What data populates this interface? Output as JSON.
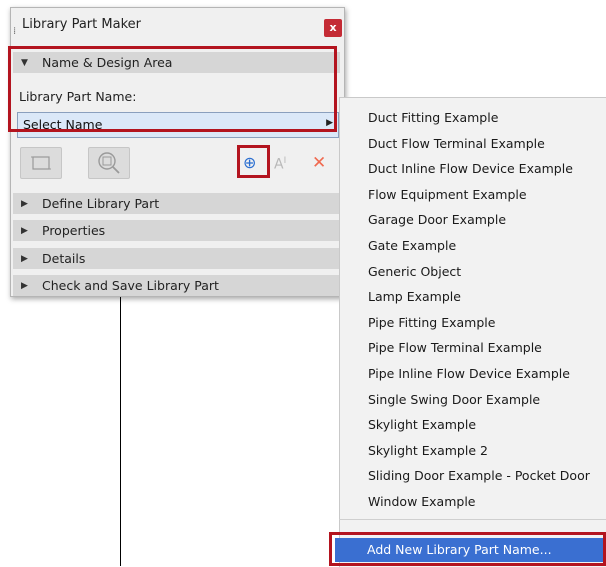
{
  "panel": {
    "title": "Library Part Maker",
    "close_label": "x",
    "name_section": {
      "header": "Name & Design Area",
      "name_label": "Library Part Name:",
      "select_value": "Select Name"
    },
    "toolbar": {
      "add_label": "⊕",
      "text_label": "A",
      "text_sup": "I",
      "delete_label": "✕"
    },
    "sections": [
      {
        "label": "Define Library Part"
      },
      {
        "label": "Properties"
      },
      {
        "label": "Details"
      },
      {
        "label": "Check and Save Library Part"
      }
    ]
  },
  "menu": {
    "items": [
      "Duct Fitting Example",
      "Duct Flow Terminal Example",
      "Duct Inline Flow Device Example",
      "Flow Equipment Example",
      "Garage Door Example",
      "Gate Example",
      "Generic Object",
      "Lamp Example",
      "Pipe Fitting Example",
      "Pipe Flow Terminal Example",
      "Pipe Inline Flow Device Example",
      "Single Swing Door Example",
      "Skylight Example",
      "Skylight Example 2",
      "Sliding Door Example - Pocket Door",
      "Window Example"
    ],
    "add_item": "Add New Library Part Name..."
  },
  "colors": {
    "highlight_red": "#b3141f",
    "menu_selected": "#3a6fd1",
    "select_bg": "#dbe8f8",
    "delete_orange": "#f06a50",
    "add_blue": "#2a6ed0"
  }
}
